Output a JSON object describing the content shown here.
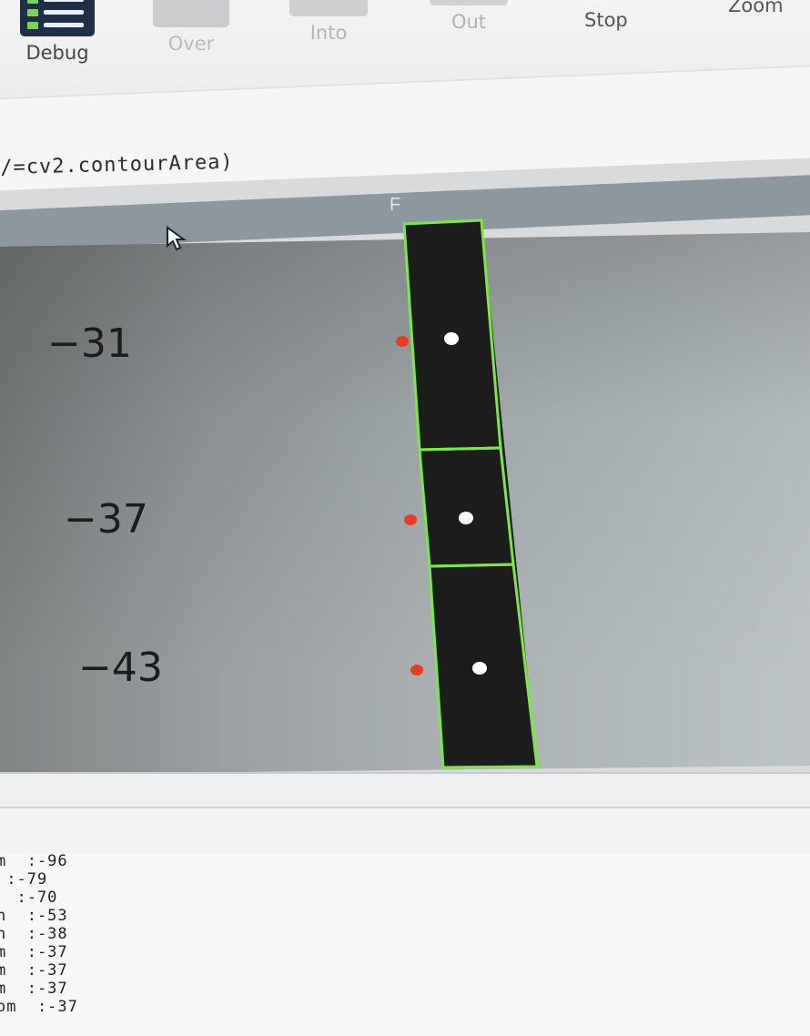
{
  "toolbar": {
    "debug": "Debug",
    "over": "Over",
    "into": "Into",
    "out": "Out",
    "stop": "Stop",
    "zoom": "Zoom"
  },
  "editor": {
    "code_fragment": "/=cv2.contourArea)"
  },
  "image_window": {
    "title": "F",
    "scale_labels": [
      "−31",
      "−37",
      "−43"
    ]
  },
  "console": {
    "lines": [
      "m  :-96",
      " :-79",
      "  :-70",
      "n  :-53",
      "n  :-38",
      "m  :-37",
      "m  :-37",
      "m  :-37",
      "om  :-37"
    ]
  },
  "colors": {
    "contour": "#7bea3f",
    "marker_red": "#ef3a22",
    "centroid_white": "#ffffff",
    "strip_fill": "#1c1c1c"
  }
}
